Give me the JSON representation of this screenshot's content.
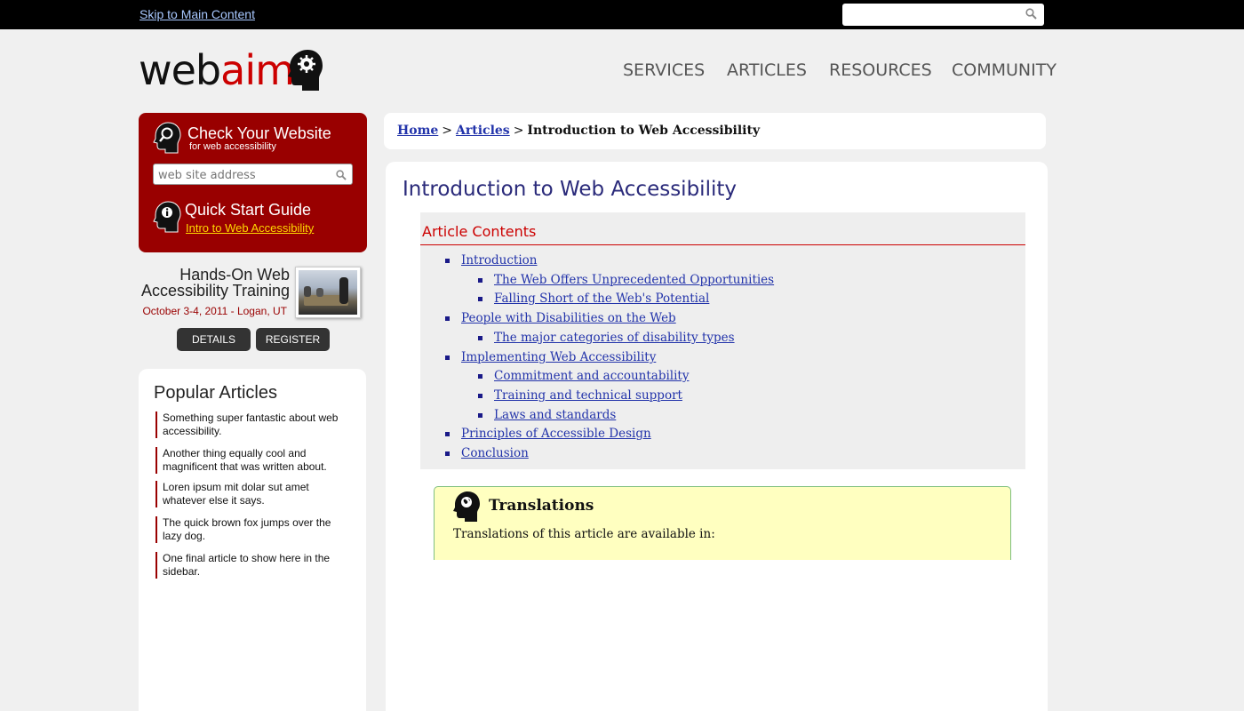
{
  "top": {
    "skip_link": "Skip to Main Content",
    "search_placeholder": ""
  },
  "logo": {
    "web": "web",
    "aim": "aim"
  },
  "nav": [
    "SERVICES",
    "ARTICLES",
    "RESOURCES",
    "COMMUNITY"
  ],
  "redbox": {
    "title": "Check Your Website",
    "subtitle": "for web accessibility",
    "search_placeholder": "web site address",
    "guide_title": "Quick Start Guide",
    "guide_link": "Intro to Web Accessibility"
  },
  "training": {
    "title_line1": "Hands-On Web",
    "title_line2": "Accessibility Training",
    "date": "October 3-4, 2011 - Logan, UT",
    "details": "DETAILS",
    "register": "REGISTER"
  },
  "popular": {
    "title": "Popular Articles",
    "items": [
      "Something super fantastic about web accessibility.",
      "Another thing equally cool and magnificent that was written about.",
      "Loren ipsum mit dolar sut amet whatever else it says.",
      "The quick brown fox jumps over the lazy dog.",
      "One final article to show here in the sidebar."
    ]
  },
  "breadcrumb": {
    "home": "Home",
    "articles": "Articles",
    "sep": ">",
    "current": "Introduction to Web Accessibility"
  },
  "article": {
    "title": "Introduction to Web Accessibility",
    "toc_title": "Article Contents",
    "toc": [
      {
        "label": "Introduction",
        "level": 1
      },
      {
        "label": "The Web Offers Unprecedented Opportunities",
        "level": 2
      },
      {
        "label": "Falling Short of the Web's Potential",
        "level": 2
      },
      {
        "label": "People with Disabilities on the Web",
        "level": 1
      },
      {
        "label": "The major categories of disability types",
        "level": 2
      },
      {
        "label": "Implementing Web Accessibility",
        "level": 1
      },
      {
        "label": "Commitment and accountability",
        "level": 2
      },
      {
        "label": "Training and technical support",
        "level": 2
      },
      {
        "label": "Laws and standards",
        "level": 2
      },
      {
        "label": "Principles of Accessible Design",
        "level": 1
      },
      {
        "label": "Conclusion",
        "level": 1
      }
    ],
    "translations_title": "Translations",
    "translations_text": "Translations of this article are available in:"
  }
}
